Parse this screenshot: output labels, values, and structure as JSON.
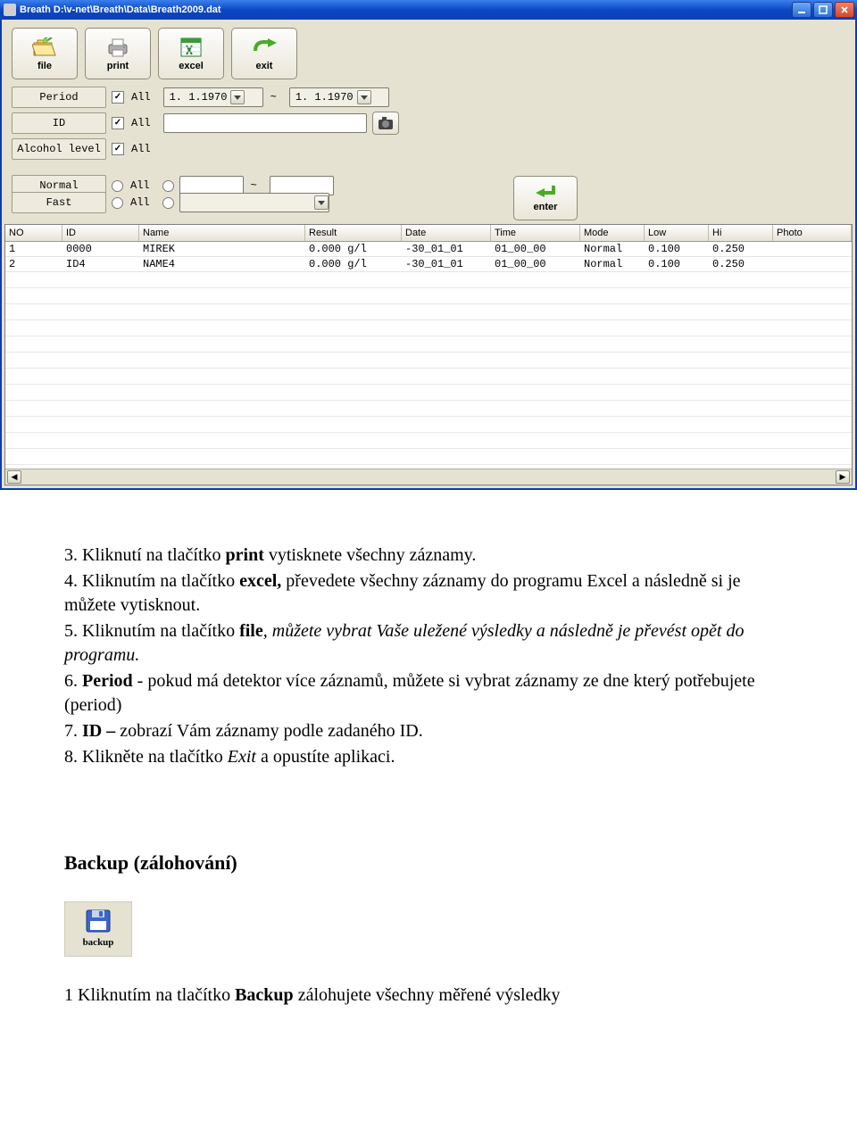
{
  "window": {
    "title": "Breath D:\\v-net\\Breath\\Data\\Breath2009.dat"
  },
  "toolbar": {
    "file": "file",
    "print": "print",
    "excel": "excel",
    "exit": "exit",
    "enter": "enter"
  },
  "filters": {
    "period_label": "Period",
    "id_label": "ID",
    "alcohol_label": "Alcohol level",
    "normal_label": "Normal",
    "fast_label": "Fast",
    "all_text": "All",
    "date_from": "1. 1.1970",
    "date_to": "1. 1.1970",
    "tilde": "~"
  },
  "columns": {
    "no": "NO",
    "id": "ID",
    "name": "Name",
    "result": "Result",
    "date": "Date",
    "time": "Time",
    "mode": "Mode",
    "low": "Low",
    "hi": "Hi",
    "photo": "Photo"
  },
  "rows": [
    {
      "no": "1",
      "id": "0000",
      "name": "MIREK",
      "result": "0.000 g/l",
      "date": "-30_01_01",
      "time": "01_00_00",
      "mode": "Normal",
      "low": "0.100",
      "hi": "0.250",
      "photo": ""
    },
    {
      "no": "2",
      "id": "ID4",
      "name": "NAME4",
      "result": "0.000 g/l",
      "date": "-30_01_01",
      "time": "01_00_00",
      "mode": "Normal",
      "low": "0.100",
      "hi": "0.250",
      "photo": ""
    }
  ],
  "doc": {
    "l3a": "3. Kliknutí na tlačítko ",
    "l3b": "print",
    "l3c": " vytisknete všechny záznamy.",
    "l4a": "4. Kliknutím na tlačítko ",
    "l4b": "excel,",
    "l4c": " převedete všechny záznamy do programu Excel a následně si je můžete vytisknout.",
    "l5a": "5. Kliknutím na tlačítko ",
    "l5b": "file",
    "l5c": ", můžete vybrat Vaše uležené výsledky a následně je převést opět do programu.",
    "l6a": "6. ",
    "l6b": "Period",
    "l6c": " - pokud má detektor více záznamů, můžete si vybrat záznamy ze dne který potřebujete (period)",
    "l7a": "7. ",
    "l7b": "ID – ",
    "l7c": "zobrazí Vám záznamy podle zadaného ID.",
    "l8a": "8. Klikněte na tlačítko ",
    "l8b": "Exit",
    "l8c": " a opustíte aplikaci.",
    "backup_h": "Backup (zálohování)",
    "backup_label": "backup",
    "b1a": "1 Kliknutím na tlačítko ",
    "b1b": "Backup",
    "b1c": " zálohujete všechny měřené výsledky"
  }
}
